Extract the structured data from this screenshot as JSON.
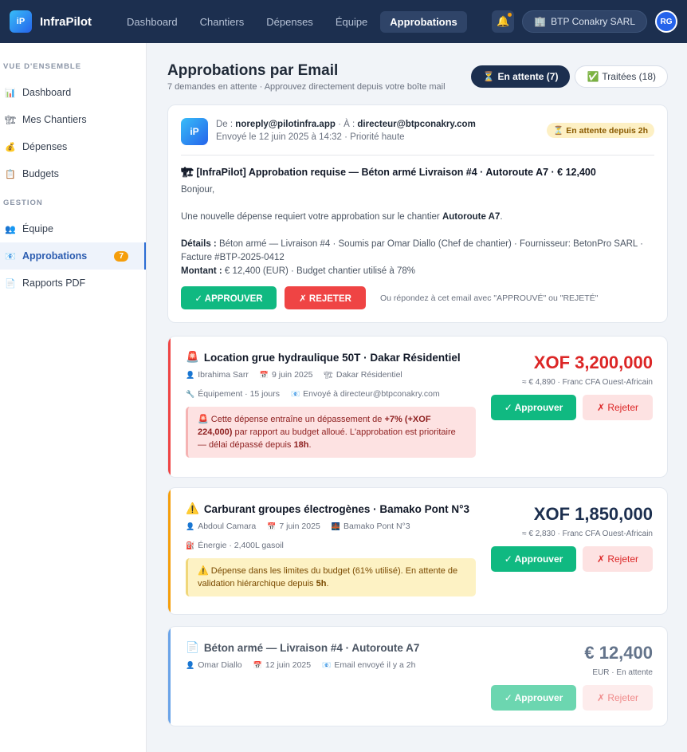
{
  "app": {
    "logo": "iP",
    "name": "InfraPilot"
  },
  "nav": [
    {
      "label": "Dashboard"
    },
    {
      "label": "Chantiers"
    },
    {
      "label": "Dépenses"
    },
    {
      "label": "Équipe"
    },
    {
      "label": "Approbations"
    }
  ],
  "topbar": {
    "company": "BTP Conakry SARL",
    "avatar": "RG",
    "company_icon": "building-icon",
    "bell_icon": "bell-icon"
  },
  "sidebar": {
    "sections": [
      {
        "title": "VUE D'ENSEMBLE",
        "items": [
          {
            "label": "Dashboard",
            "icon": "📊"
          },
          {
            "label": "Mes Chantiers",
            "icon": "🏗"
          },
          {
            "label": "Dépenses",
            "icon": "💰"
          },
          {
            "label": "Budgets",
            "icon": "📋"
          }
        ]
      },
      {
        "title": "GESTION",
        "items": [
          {
            "label": "Équipe",
            "icon": "👥"
          },
          {
            "label": "Approbations",
            "icon": "📧",
            "badge": "7"
          },
          {
            "label": "Rapports PDF",
            "icon": "📄"
          }
        ]
      }
    ]
  },
  "page": {
    "title": "Approbations par Email",
    "subtitle": "7 demandes en attente · Approuvez directement depuis votre boîte mail",
    "filters": [
      {
        "icon": "⏳",
        "label": "En attente (7)"
      },
      {
        "icon": "✅",
        "label": "Traitées (18)"
      }
    ]
  },
  "email": {
    "logo": "iP",
    "from_label": "De :",
    "from": "noreply@pilotinfra.app",
    "to_label": "· À :",
    "to": "directeur@btpconakry.com",
    "sent": "Envoyé le 12 juin 2025 à 14:32 · Priorité haute",
    "wait": "⏳ En attente depuis 2h",
    "subject": "🏗 [InfraPilot] Approbation requise — Béton armé Livraison #4 · Autoroute A7 · € 12,400",
    "greeting": "Bonjour,",
    "line1_pre": "Une nouvelle dépense requiert votre approbation sur le chantier ",
    "line1_bold": "Autoroute A7",
    "line1_post": ".",
    "details_label": "Détails :",
    "details": " Béton armé — Livraison #4 · Soumis par Omar Diallo (Chef de chantier) · Fournisseur: BetonPro SARL · Facture #BTP-2025-0412",
    "amount_label": "Montant :",
    "amount": " € 12,400 (EUR) · Budget chantier utilisé à 78%",
    "approve": "✓ APPROUVER",
    "reject": "✗ REJETER",
    "hint": "Ou répondez à cet email avec \"APPROUVÉ\" ou \"REJETÉ\""
  },
  "requests": [
    {
      "icon": "🚨",
      "title": "Location grue hydraulique 50T · Dakar Résidentiel",
      "accent": "#ef4444",
      "amount_color": "#dc2626",
      "meta1": [
        {
          "icon": "👤",
          "text": "Ibrahima Sarr"
        },
        {
          "icon": "📅",
          "text": "9 juin 2025"
        },
        {
          "icon": "🏗",
          "text": "Dakar Résidentiel"
        }
      ],
      "meta2": [
        {
          "icon": "🔧",
          "text": "Équipement · 15 jours"
        },
        {
          "icon": "📧",
          "text": "Envoyé à directeur@btpconakry.com"
        }
      ],
      "alert_type": "red",
      "alert_pre": "🚨 Cette dépense entraîne un dépassement de ",
      "alert_bold1": "+7% (+XOF 224,000)",
      "alert_mid": " par rapport au budget alloué. L'approbation est prioritaire — délai dépassé depuis ",
      "alert_bold2": "18h",
      "alert_post": ".",
      "amount": "XOF 3,200,000",
      "amount_sub": "≈ € 4,890 · Franc CFA Ouest-Africain",
      "approve": "✓ Approuver",
      "reject": "✗ Rejeter"
    },
    {
      "icon": "⚠️",
      "title": "Carburant groupes électrogènes · Bamako Pont N°3",
      "accent": "#f59e0b",
      "amount_color": "#1c2f4f",
      "meta1": [
        {
          "icon": "👤",
          "text": "Abdoul Camara"
        },
        {
          "icon": "📅",
          "text": "7 juin 2025"
        },
        {
          "icon": "🌉",
          "text": "Bamako Pont N°3"
        }
      ],
      "meta2": [
        {
          "icon": "⛽",
          "text": "Énergie · 2,400L gasoil"
        }
      ],
      "alert_type": "yellow",
      "alert_pre": "⚠️ Dépense dans les limites du budget (61% utilisé). En attente de validation hiérarchique depuis ",
      "alert_bold1": "5h",
      "alert_mid": "",
      "alert_bold2": "",
      "alert_post": ".",
      "amount": "XOF 1,850,000",
      "amount_sub": "≈ € 2,830 · Franc CFA Ouest-Africain",
      "approve": "✓ Approuver",
      "reject": "✗ Rejeter"
    },
    {
      "icon": "📄",
      "title": "Béton armé — Livraison #4 · Autoroute A7",
      "accent": "#6aa3e8",
      "amount_color": "#64748b",
      "meta1": [
        {
          "icon": "👤",
          "text": "Omar Diallo"
        },
        {
          "icon": "📅",
          "text": "12 juin 2025"
        },
        {
          "icon": "📧",
          "text": "Email envoyé il y a 2h"
        }
      ],
      "meta2": [],
      "alert_type": "",
      "amount": "€ 12,400",
      "amount_sub": "EUR · En attente",
      "approve": "✓ Approuver",
      "reject": "✗ Rejeter"
    }
  ]
}
